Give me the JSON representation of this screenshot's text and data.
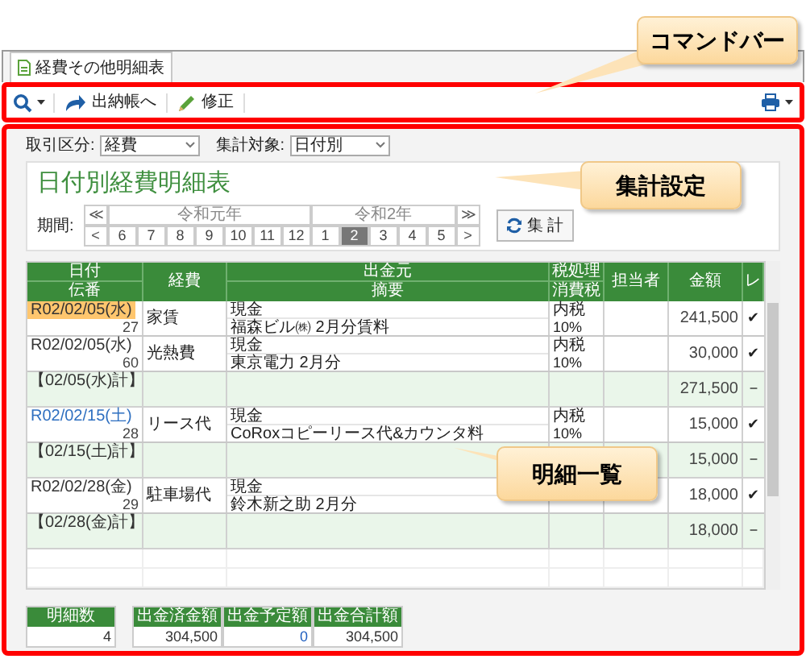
{
  "tab": {
    "label": "経費その他明細表",
    "selected": true
  },
  "command_bar": {
    "actions": [
      {
        "kind": "forward",
        "label": "出納帳へ"
      },
      {
        "kind": "edit",
        "label": "修正"
      }
    ]
  },
  "filters": [
    {
      "label": "取引区分:",
      "value": "経費"
    },
    {
      "label": "集計対象:",
      "value": "日付別"
    }
  ],
  "report": {
    "title": "日付別経費明細表",
    "period_label": "期間:",
    "nav_prev": [
      "≪",
      "<"
    ],
    "nav_next": [
      "≫",
      ">"
    ],
    "years": [
      {
        "label": "令和元年",
        "months": [
          {
            "label": "6",
            "selected": false
          },
          {
            "label": "7",
            "selected": false
          },
          {
            "label": "8",
            "selected": false
          },
          {
            "label": "9",
            "selected": false
          },
          {
            "label": "10",
            "selected": false
          },
          {
            "label": "11",
            "selected": false
          },
          {
            "label": "12",
            "selected": false
          }
        ]
      },
      {
        "label": "令和2年",
        "months": [
          {
            "label": "1",
            "selected": false
          },
          {
            "label": "2",
            "selected": true
          },
          {
            "label": "3",
            "selected": false
          },
          {
            "label": "4",
            "selected": false
          },
          {
            "label": "5",
            "selected": false
          }
        ]
      }
    ],
    "aggregate_button": "集 計"
  },
  "grid": {
    "columns": [
      {
        "top": "日付",
        "bottom": "伝番"
      },
      {
        "top": "経費"
      },
      {
        "top": "出金元",
        "bottom": "摘要"
      },
      {
        "top": "税処理",
        "bottom": "消費税"
      },
      {
        "top": "担当者"
      },
      {
        "top": "金額"
      },
      {
        "top": "レ"
      }
    ],
    "rows": [
      {
        "kind": "entry",
        "selected": true,
        "color": "#333333",
        "date": "R02/02/05(水)",
        "number": "27",
        "expense": "家賃",
        "source": "現金",
        "memo": "福森ビル㈱ 2月分賃料",
        "tax": "内税",
        "tax_rate": "10%",
        "amount": "241,500",
        "mark": "✔"
      },
      {
        "kind": "entry",
        "selected": false,
        "color": "#333333",
        "date": "R02/02/05(水)",
        "number": "60",
        "expense": "光熱費",
        "source": "現金",
        "memo": "東京電力 2月分",
        "tax": "内税",
        "tax_rate": "10%",
        "amount": "30,000",
        "mark": "✔"
      },
      {
        "kind": "subtotal",
        "label": "【02/05(水)計】",
        "amount": "271,500",
        "mark": "−"
      },
      {
        "kind": "entry",
        "selected": false,
        "color": "#2e6fc0",
        "date": "R02/02/15(土)",
        "number": "28",
        "expense": "リース代",
        "source": "現金",
        "memo": "CoRoxコピーリース代&カウンタ料",
        "tax": "内税",
        "tax_rate": "10%",
        "amount": "15,000",
        "mark": "✔"
      },
      {
        "kind": "subtotal",
        "label": "【02/15(土)計】",
        "amount": "15,000",
        "mark": "−"
      },
      {
        "kind": "entry",
        "selected": false,
        "color": "#333333",
        "date": "R02/02/28(金)",
        "number": "29",
        "expense": "駐車場代",
        "source": "現金",
        "memo": "鈴木新之助 2月分",
        "amount": "18,000",
        "mark": "✔"
      },
      {
        "kind": "subtotal",
        "label": "【02/28(金)計】",
        "amount": "18,000",
        "mark": "−"
      }
    ]
  },
  "totals": [
    {
      "label": "明細数",
      "value": "4",
      "kind": "plain"
    },
    {
      "label": "出金済金額",
      "value": "304,500",
      "kind": "plain"
    },
    {
      "label": "出金予定額",
      "value": "0",
      "kind": "link"
    },
    {
      "label": "出金合計額",
      "value": "304,500",
      "kind": "plain"
    }
  ],
  "callouts": [
    {
      "text": "コマンドバー"
    },
    {
      "text": "集計設定"
    },
    {
      "text": "明細一覧"
    }
  ]
}
